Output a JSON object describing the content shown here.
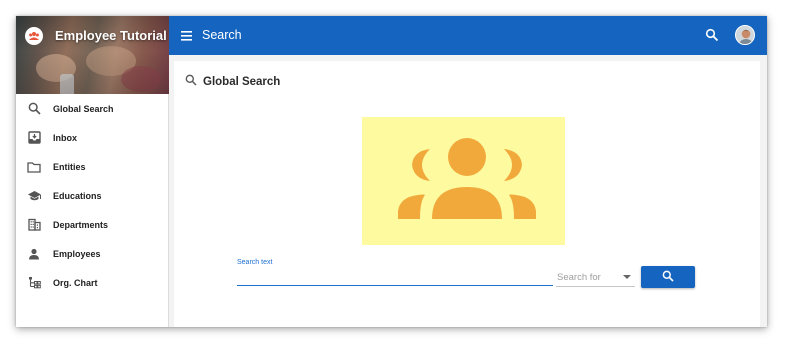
{
  "app": {
    "title": "Employee Tutorial"
  },
  "topbar": {
    "title": "Search"
  },
  "sidebar": {
    "items": [
      {
        "label": "Global Search",
        "icon": "search-icon"
      },
      {
        "label": "Inbox",
        "icon": "inbox-icon"
      },
      {
        "label": "Entities",
        "icon": "folder-icon"
      },
      {
        "label": "Educations",
        "icon": "graduation-cap-icon"
      },
      {
        "label": "Departments",
        "icon": "building-icon"
      },
      {
        "label": "Employees",
        "icon": "person-icon"
      },
      {
        "label": "Org. Chart",
        "icon": "org-chart-icon"
      }
    ]
  },
  "main": {
    "title": "Global Search",
    "illustration_icon": "people-group-icon",
    "search": {
      "label": "Search text",
      "value": "",
      "select_placeholder": "Search for",
      "button_icon": "search-icon"
    }
  },
  "colors": {
    "primary": "#1565c0",
    "illustration_bg": "#fdfaa0",
    "illustration_fg": "#f2a93b"
  }
}
